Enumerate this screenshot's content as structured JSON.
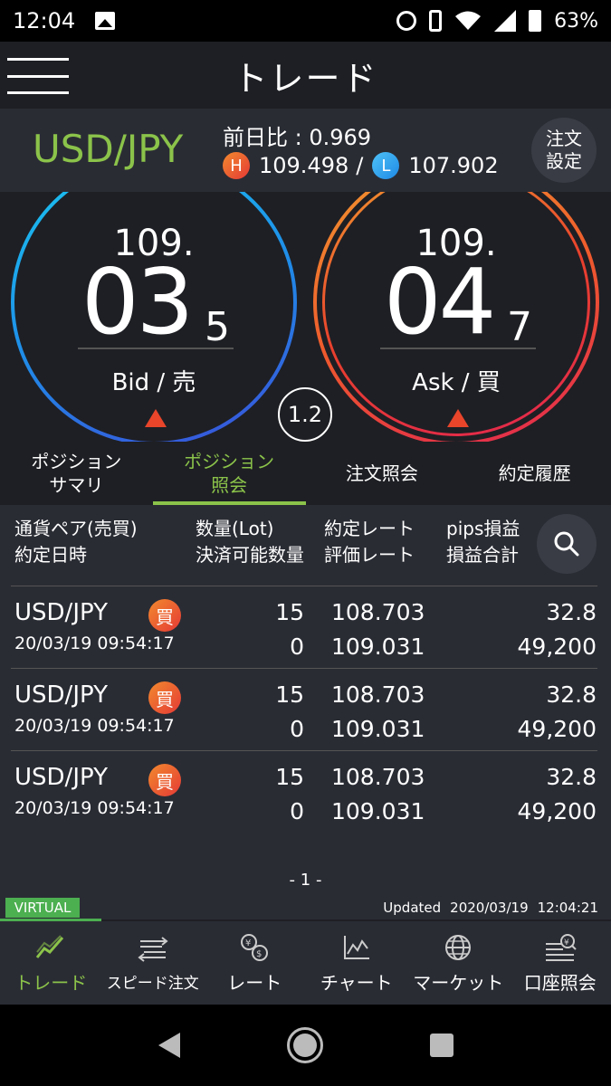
{
  "status": {
    "time": "12:04",
    "battery": "63%"
  },
  "header": {
    "title": "トレード"
  },
  "pair": {
    "name": "USD/JPY",
    "change": "前日比 : 0.969",
    "high_badge": "H",
    "high": "109.498",
    "separator": "/",
    "low_badge": "L",
    "low": "107.902",
    "settings_line1": "注文",
    "settings_line2": "設定"
  },
  "bid": {
    "big": "109.",
    "main": "03",
    "pip": "5",
    "label": "Bid / 売"
  },
  "ask": {
    "big": "109.",
    "main": "04",
    "pip": "7",
    "label": "Ask / 買"
  },
  "spread": "1.2",
  "tabs": [
    {
      "line1": "ポジション",
      "line2": "サマリ"
    },
    {
      "line1": "ポジション",
      "line2": "照会"
    },
    {
      "line1": "注文照会",
      "line2": ""
    },
    {
      "line1": "約定履歴",
      "line2": ""
    }
  ],
  "columns": {
    "c1a": "通貨ペア(売買)",
    "c1b": "約定日時",
    "c2a": "数量(Lot)",
    "c2b": "決済可能数量",
    "c3a": "約定レート",
    "c3b": "評価レート",
    "c4a": "pips損益",
    "c4b": "損益合計"
  },
  "rows": [
    {
      "pair": "USD/JPY",
      "side": "買",
      "date": "20/03/19 09:54:17",
      "qty": "15",
      "avail": "0",
      "rate": "108.703",
      "eval": "109.031",
      "pips": "32.8",
      "total": "49,200"
    },
    {
      "pair": "USD/JPY",
      "side": "買",
      "date": "20/03/19 09:54:17",
      "qty": "15",
      "avail": "0",
      "rate": "108.703",
      "eval": "109.031",
      "pips": "32.8",
      "total": "49,200"
    },
    {
      "pair": "USD/JPY",
      "side": "買",
      "date": "20/03/19 09:54:17",
      "qty": "15",
      "avail": "0",
      "rate": "108.703",
      "eval": "109.031",
      "pips": "32.8",
      "total": "49,200"
    }
  ],
  "page": "- 1 -",
  "footer": {
    "virtual": "VIRTUAL",
    "updated_label": "Updated",
    "updated_date": "2020/03/19",
    "updated_time": "12:04:21"
  },
  "nav": [
    {
      "label": "トレード",
      "icon": "trade-chart-icon"
    },
    {
      "label": "スピード注文",
      "icon": "speed-order-icon"
    },
    {
      "label": "レート",
      "icon": "rate-currency-icon"
    },
    {
      "label": "チャート",
      "icon": "chart-icon"
    },
    {
      "label": "マーケット",
      "icon": "globe-icon"
    },
    {
      "label": "口座照会",
      "icon": "account-icon"
    }
  ],
  "colors": {
    "accent": "#8bc34a",
    "bg": "#1e1f24",
    "panel": "#2a2c34",
    "buy": "#e53935",
    "sell": "#1e88e5"
  }
}
